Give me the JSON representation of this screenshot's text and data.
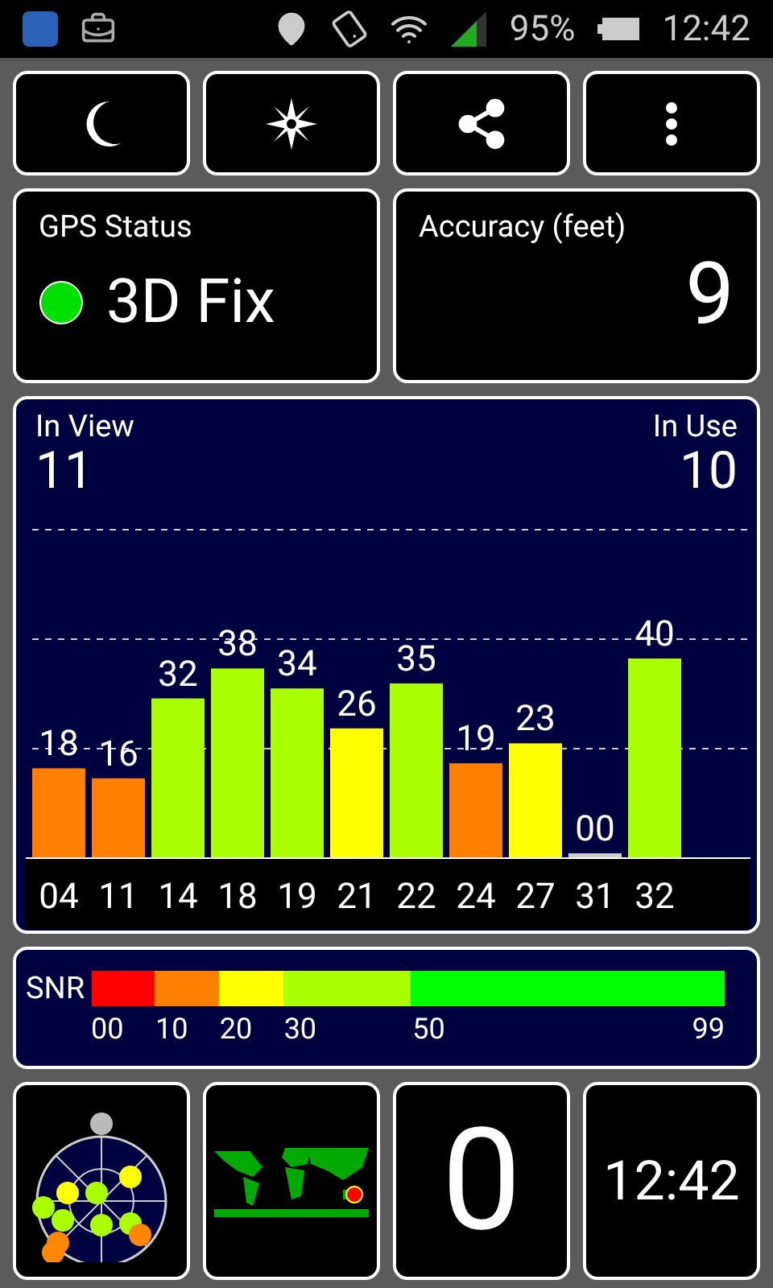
{
  "status_bar": {
    "battery": "95%",
    "time": "12:42"
  },
  "gps_status": {
    "title": "GPS Status",
    "fix": "3D Fix",
    "color": "#00e000"
  },
  "accuracy": {
    "title": "Accuracy (feet)",
    "value": "9"
  },
  "satellites": {
    "in_view_label": "In View",
    "in_view": "11",
    "in_use_label": "In Use",
    "in_use": "10",
    "chart_data": {
      "type": "bar",
      "categories": [
        "04",
        "11",
        "14",
        "18",
        "19",
        "21",
        "22",
        "24",
        "27",
        "31",
        "32"
      ],
      "values": [
        18,
        16,
        32,
        38,
        34,
        26,
        35,
        19,
        23,
        0,
        40
      ],
      "value_labels": [
        "18",
        "16",
        "32",
        "38",
        "34",
        "26",
        "35",
        "19",
        "23",
        "00",
        "40"
      ]
    }
  },
  "snr_legend": {
    "label": "SNR",
    "segments": [
      {
        "label": "00",
        "color": "#ff0000"
      },
      {
        "label": "10",
        "color": "#ff8000"
      },
      {
        "label": "20",
        "color": "#ffff00"
      },
      {
        "label": "30",
        "color": "#aaff00"
      },
      {
        "label": "50",
        "color": "#00ff00"
      }
    ],
    "end_label": "99"
  },
  "bottom": {
    "counter": "0",
    "clock": "12:42"
  }
}
